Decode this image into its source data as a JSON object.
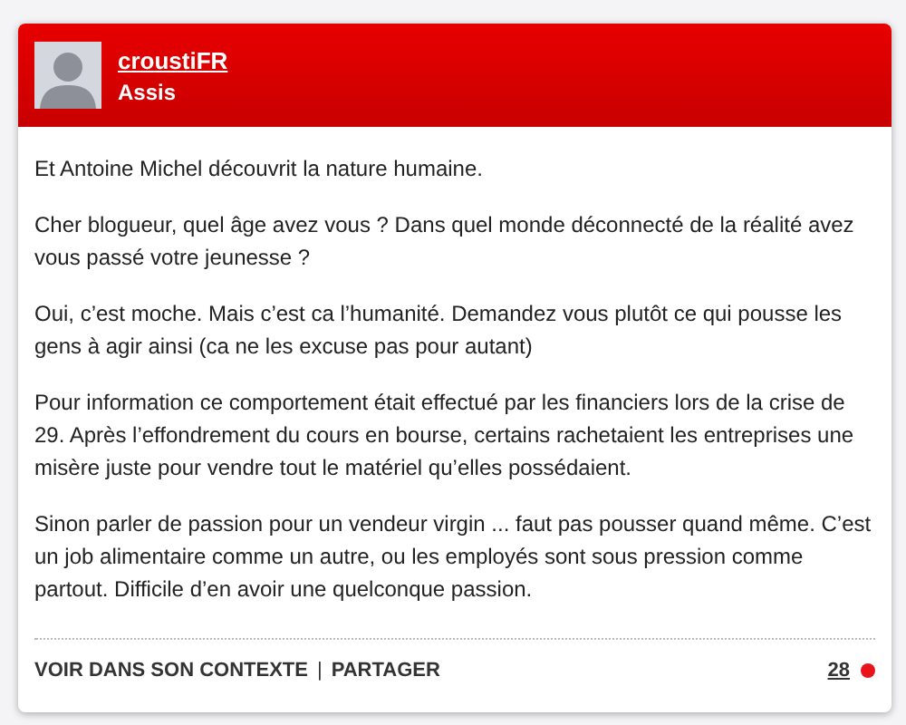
{
  "author": {
    "name": "croustiFR",
    "subtitle": "Assis"
  },
  "paragraphs": [
    "Et Antoine Michel découvrit la nature humaine.",
    "Cher blogueur, quel âge avez vous ? Dans quel monde déconnecté de la réalité avez vous passé votre jeunesse ?",
    "Oui, c’est moche. Mais c’est ca l’humanité. Demandez vous plutôt ce qui pousse les gens à agir ainsi (ca ne les excuse pas pour autant)",
    "Pour information ce comportement était effectué par les financiers lors de la crise de 29. Après l’effondrement du cours en bourse, certains rachetaient les entreprises une misère juste pour vendre tout le matériel qu’elles possédaient.",
    "Sinon parler de passion pour un vendeur virgin ... faut pas pousser quand même. C’est un job alimentaire comme un autre, ou les employés sont sous pression comme partout. Difficile d’en avoir une quelconque passion."
  ],
  "footer": {
    "links": [
      "VOIR DANS SON CONTEXTE",
      "PARTAGER"
    ],
    "separator": "|",
    "count": "28"
  }
}
